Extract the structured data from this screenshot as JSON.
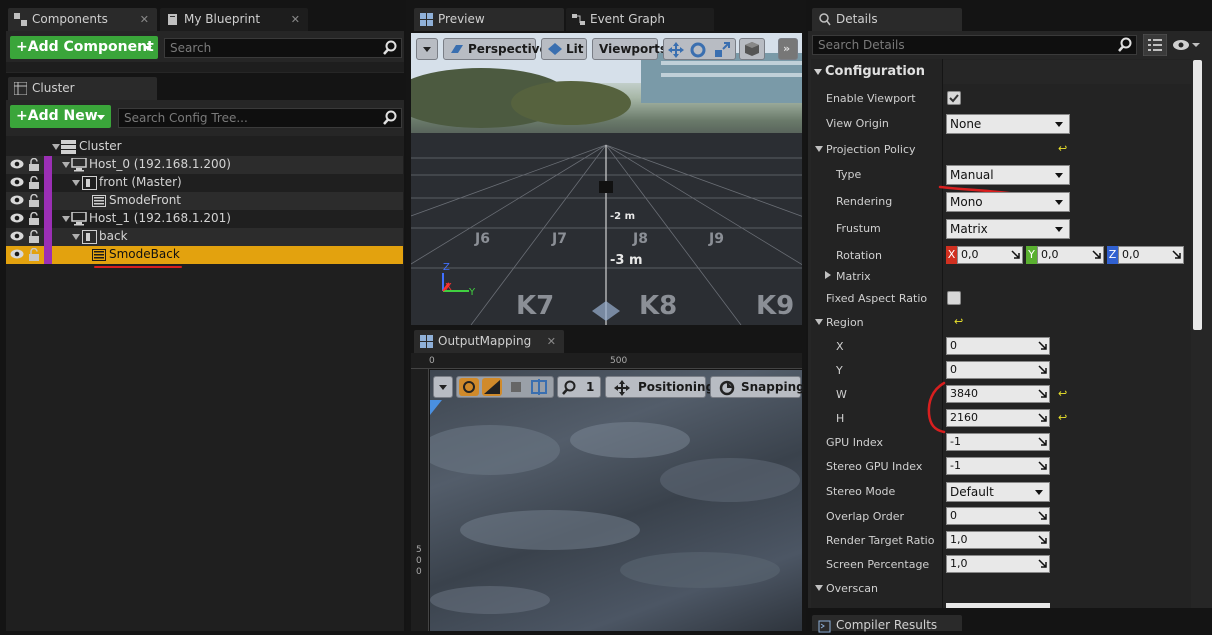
{
  "left_top_tabs": {
    "components": "Components",
    "blueprint": "My Blueprint"
  },
  "components": {
    "add_label": "+Add Component",
    "search_placeholder": "Search"
  },
  "cluster_tab": "Cluster",
  "cluster": {
    "add_label": "+Add New",
    "search_placeholder": "Search Config Tree...",
    "tree": [
      {
        "label": "Cluster"
      },
      {
        "label": "Host_0 (192.168.1.200)"
      },
      {
        "label": "front (Master)"
      },
      {
        "label": "SmodeFront"
      },
      {
        "label": "Host_1 (192.168.1.201)"
      },
      {
        "label": "back"
      },
      {
        "label": "SmodeBack",
        "selected": true
      }
    ]
  },
  "center_tabs": {
    "preview": "Preview",
    "event_graph": "Event Graph",
    "output_mapping": "OutputMapping"
  },
  "viewport": {
    "perspective": "Perspective",
    "lit": "Lit",
    "viewports": "Viewports",
    "grid_labels": [
      "J6",
      "J7",
      "J8",
      "J9",
      "K7",
      "K8",
      "K9",
      "-3 m",
      "-2 m"
    ],
    "axis_z": "Z",
    "axis_x": "X",
    "axis_y": "Y"
  },
  "output_mapping": {
    "ruler_0": "0",
    "ruler_500": "500",
    "positioning": "Positioning",
    "snapping": "Snapping",
    "zoom": "1",
    "vruler": [
      "5",
      "0",
      "0"
    ]
  },
  "details": {
    "tab": "Details",
    "search_placeholder": "Search Details",
    "section": "Configuration",
    "rows": {
      "enable_viewport": "Enable Viewport",
      "view_origin": "View Origin",
      "view_origin_val": "None",
      "projection_policy": "Projection Policy",
      "type": "Type",
      "type_val": "Manual",
      "rendering": "Rendering",
      "rendering_val": "Mono",
      "frustum": "Frustum",
      "frustum_val": "Matrix",
      "rotation": "Rotation",
      "rot_x": "0,0",
      "rot_y": "0,0",
      "rot_z": "0,0",
      "matrix": "Matrix",
      "fixed_aspect": "Fixed Aspect Ratio",
      "region": "Region",
      "x": "X",
      "x_val": "0",
      "y": "Y",
      "y_val": "0",
      "w": "W",
      "w_val": "3840",
      "h": "H",
      "h_val": "2160",
      "gpu_index": "GPU Index",
      "gpu_index_val": "-1",
      "stereo_gpu": "Stereo GPU Index",
      "stereo_gpu_val": "-1",
      "stereo_mode": "Stereo Mode",
      "stereo_mode_val": "Default",
      "overlap": "Overlap Order",
      "overlap_val": "0",
      "rt_ratio": "Render Target Ratio",
      "rt_ratio_val": "1,0",
      "screen_pct": "Screen Percentage",
      "screen_pct_val": "1,0",
      "overscan": "Overscan"
    }
  },
  "compiler_tab": "Compiler Results",
  "colors": {
    "accent_green": "#3aa53a",
    "selection": "#e3a20e",
    "purple": "#9b2fb5",
    "annotation_red": "#d81f1f"
  }
}
